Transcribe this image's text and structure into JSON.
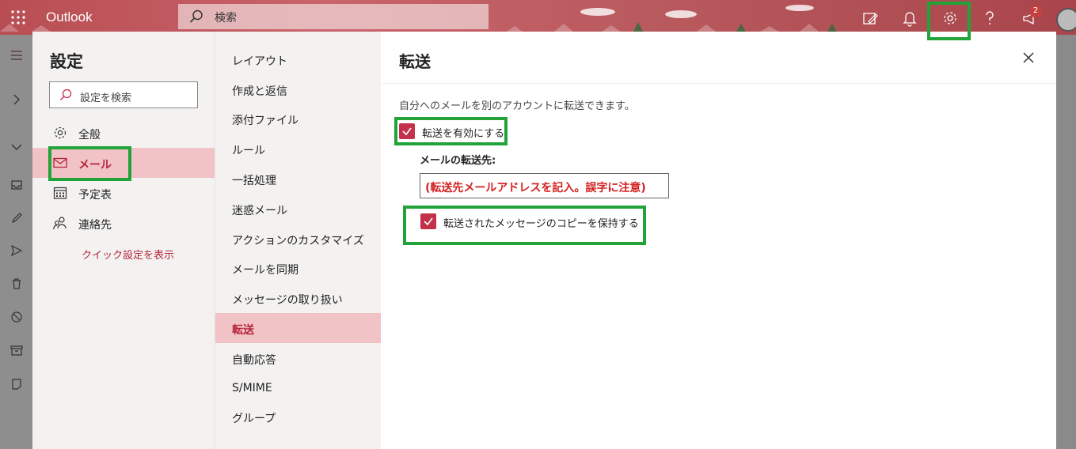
{
  "app": {
    "name": "Outlook",
    "search_placeholder": "検索",
    "notification_count": "2"
  },
  "settings": {
    "title": "設定",
    "search_placeholder": "設定を検索",
    "categories": [
      {
        "label": "全般",
        "icon": "gear-icon"
      },
      {
        "label": "メール",
        "icon": "mail-icon"
      },
      {
        "label": "予定表",
        "icon": "calendar-icon"
      },
      {
        "label": "連絡先",
        "icon": "people-icon"
      }
    ],
    "quick_settings_link": "クイック設定を表示",
    "mail_subitems": [
      "レイアウト",
      "作成と返信",
      "添付ファイル",
      "ルール",
      "一括処理",
      "迷惑メール",
      "アクションのカスタマイズ",
      "メールを同期",
      "メッセージの取り扱い",
      "転送",
      "自動応答",
      "S/MIME",
      "グループ"
    ]
  },
  "forwarding": {
    "title": "転送",
    "description": "自分へのメールを別のアカウントに転送できます。",
    "enable_label": "転送を有効にする",
    "enable_checked": true,
    "address_label": "メールの転送先:",
    "address_value": "(転送先メールアドレスを記入。誤字に注意)",
    "keep_copy_label": "転送されたメッセージのコピーを保持する",
    "keep_copy_checked": true
  },
  "colors": {
    "accent": "#c4314b",
    "highlight_box": "#22a33a",
    "selected_bg": "#f1c3c6",
    "note_red": "#d42020"
  }
}
